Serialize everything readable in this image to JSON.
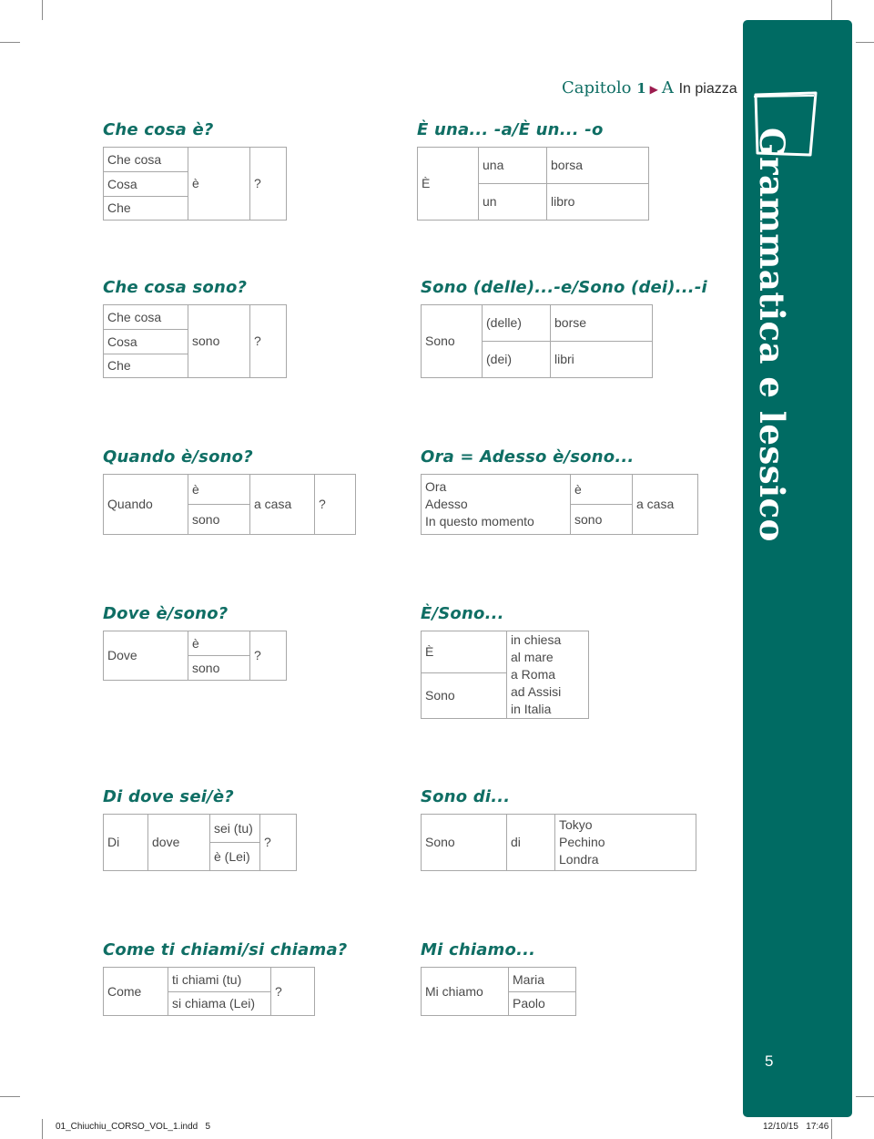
{
  "header": {
    "chapter_label": "Capitolo",
    "chapter_number": "1",
    "section_letter": "A",
    "section_title": "In piazza"
  },
  "sidebar": {
    "title": "Grammatica e lessico",
    "color": "#006b63",
    "page_number": "5"
  },
  "footer": {
    "file": "01_Chiuchiu_CORSO_VOL_1.indd   5",
    "timestamp": "12/10/15   17:46"
  },
  "sections": [
    {
      "heading": "Che cosa è?",
      "c": [
        "Che cosa",
        "Cosa",
        "Che",
        "è",
        "?"
      ]
    },
    {
      "heading": "È una... -a/È un... -o",
      "c": [
        "È",
        "una",
        "borsa",
        "un",
        "libro"
      ]
    },
    {
      "heading": "Che cosa sono?",
      "c": [
        "Che cosa",
        "Cosa",
        "Che",
        "sono",
        "?"
      ]
    },
    {
      "heading": "Sono (delle)...-e/Sono (dei)...-i",
      "c": [
        "Sono",
        "(delle)",
        "borse",
        "(dei)",
        "libri"
      ]
    },
    {
      "heading": "Quando è/sono?",
      "c": [
        "Quando",
        "è",
        "a casa",
        "?",
        "sono"
      ]
    },
    {
      "heading": "Ora = Adesso è/sono...",
      "c": [
        "Ora",
        "Adesso",
        "In questo momento",
        "è",
        "a casa",
        "sono"
      ]
    },
    {
      "heading": "Dove è/sono?",
      "c": [
        "Dove",
        "è",
        "?",
        "sono"
      ]
    },
    {
      "heading": "È/Sono...",
      "c": [
        "È",
        "in chiesa",
        "al mare",
        "a Roma",
        "ad Assisi",
        "in Italia",
        "Sono"
      ]
    },
    {
      "heading": "Di dove sei/è?",
      "c": [
        "Di",
        "dove",
        "sei (tu)",
        "?",
        "è (Lei)"
      ]
    },
    {
      "heading": "Sono di...",
      "c": [
        "Sono",
        "di",
        "Tokyo",
        "Pechino",
        "Londra"
      ]
    },
    {
      "heading": "Come ti chiami/si chiama?",
      "c": [
        "Come",
        "ti chiami (tu)",
        "?",
        "si chiama (Lei)"
      ]
    },
    {
      "heading": "Mi chiamo...",
      "c": [
        "Mi chiamo",
        "Maria",
        "Paolo"
      ]
    }
  ]
}
